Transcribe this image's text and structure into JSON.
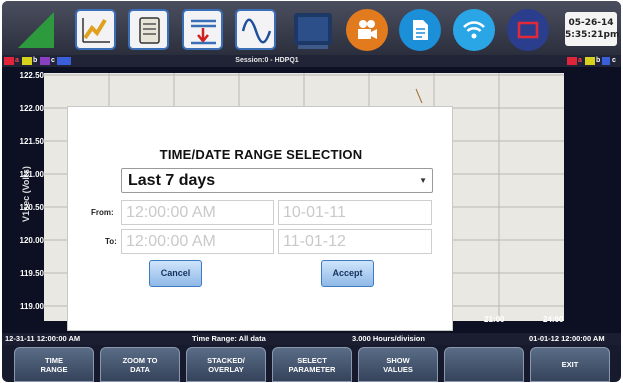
{
  "toolbar": {
    "datetime_date": "05-26-14",
    "datetime_time": "5:35:21pm",
    "icons": [
      "logo-triangle-icon",
      "trend-chart-icon",
      "scroll-icon",
      "insert-marker-icon",
      "waveform-icon",
      "monitor-icon",
      "video-camera-icon",
      "document-icon",
      "wifi-icon",
      "frame-icon"
    ]
  },
  "session": {
    "title": "Session:0 - HDPQ1",
    "channels_left": [
      "a",
      "b",
      "c"
    ],
    "channels_right": [
      "a",
      "b",
      "c"
    ]
  },
  "chart": {
    "ylabel": "V1sec (Volts)",
    "yticks": [
      "122.50",
      "122.00",
      "121.50",
      "121.00",
      "120.50",
      "120.00",
      "119.50",
      "119.00"
    ],
    "xticks": [
      "21:00",
      "24:00"
    ]
  },
  "info": {
    "start": "12-31-11 12:00:00 AM",
    "time_range": "Time Range: All data",
    "scale": "3.000 Hours/division",
    "end": "01-01-12 12:00:00 AM"
  },
  "softkeys": [
    {
      "line1": "TIME",
      "line2": "RANGE"
    },
    {
      "line1": "ZOOM TO",
      "line2": "DATA"
    },
    {
      "line1": "STACKED/",
      "line2": "OVERLAY"
    },
    {
      "line1": "SELECT",
      "line2": "PARAMETER"
    },
    {
      "line1": "SHOW",
      "line2": "VALUES"
    },
    {
      "line1": "",
      "line2": ""
    },
    {
      "line1": "EXIT",
      "line2": ""
    }
  ],
  "dialog": {
    "title": "TIME/DATE RANGE SELECTION",
    "range_value": "Last 7 days",
    "from_label": "From:",
    "to_label": "To:",
    "from_time": "12:00:00 AM",
    "from_date": "10-01-11",
    "to_time": "12:00:00 AM",
    "to_date": "11-01-12",
    "cancel_label": "Cancel",
    "accept_label": "Accept"
  },
  "colors": {
    "channel_a": "#e0243a",
    "channel_b": "#d8d21c",
    "channel_c": "#3a5fd8",
    "accent": "#3a6fb8"
  }
}
